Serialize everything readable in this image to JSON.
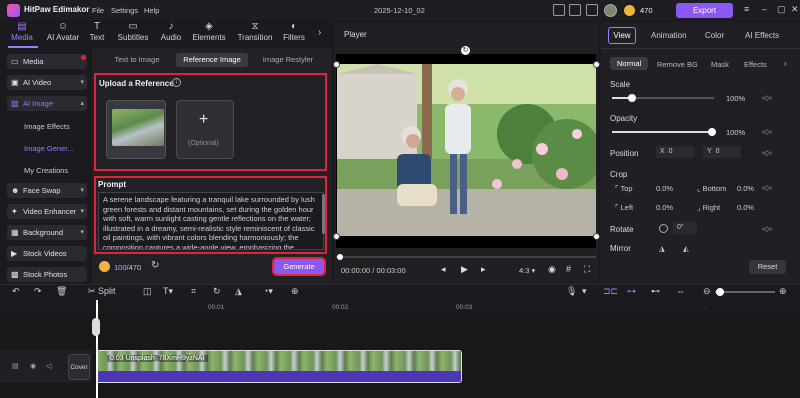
{
  "app": {
    "name": "HitPaw Edimakor",
    "menus": [
      "File",
      "Settings",
      "Help"
    ],
    "doc_title": "2025-12-10_02",
    "coins": "470",
    "export_label": "Export"
  },
  "toolbar": {
    "items": [
      {
        "label": "Media",
        "icon": "media-icon"
      },
      {
        "label": "AI Avatar",
        "icon": "ai-avatar-icon"
      },
      {
        "label": "Text",
        "icon": "text-icon"
      },
      {
        "label": "Subtitles",
        "icon": "subtitles-icon"
      },
      {
        "label": "Audio",
        "icon": "audio-icon"
      },
      {
        "label": "Elements",
        "icon": "elements-icon"
      },
      {
        "label": "Transition",
        "icon": "transition-icon"
      },
      {
        "label": "Filters",
        "icon": "filters-icon"
      }
    ]
  },
  "sidebar": {
    "items": [
      "Media",
      "AI Video",
      "AI Image",
      "Face Swap",
      "Video Enhancer",
      "Background",
      "Stock Videos",
      "Stock Photos"
    ],
    "subitems": [
      "Image Effects",
      "Image Gener...",
      "My Creations"
    ]
  },
  "center": {
    "tabs": [
      "Text to Image",
      "Reference Image",
      "Image Restyler"
    ],
    "upload_title": "Upload a Reference",
    "optional": "(Optional)",
    "prompt_title": "Prompt",
    "prompt_text": "A serene landscape featuring a tranquil lake surrounded by lush green forests and distant mountains, set during the golden hour with soft, warm sunlight casting gentle reflections on the water; illustrated in a dreamy, semi-realistic style reminiscent of classic oil paintings, with vibrant colors blending harmoniously; the composition captures a wide-angle view, emphasizing the",
    "credits_used": "100",
    "credits_total": "/470",
    "generate_label": "Generate"
  },
  "player": {
    "title": "Player",
    "time": "00:00:00 / 00:03:00",
    "aspect": "4:3"
  },
  "props": {
    "tabs": [
      "View",
      "Animation",
      "Color",
      "AI Effects"
    ],
    "subtabs": [
      "Normal",
      "Remove BG",
      "Mask",
      "Effects"
    ],
    "scale_label": "Scale",
    "scale_value": "100%",
    "opacity_label": "Opacity",
    "opacity_value": "100%",
    "position_label": "Position",
    "pos_x_label": "X",
    "pos_x": "0",
    "pos_y_label": "Y",
    "pos_y": "0",
    "crop_label": "Crop",
    "crop": [
      {
        "label": "Top",
        "value": "0.0%"
      },
      {
        "label": "Bottom",
        "value": "0.0%"
      },
      {
        "label": "Left",
        "value": "0.0%"
      },
      {
        "label": "Right",
        "value": "0.0%"
      }
    ],
    "rotate_label": "Rotate",
    "rotate_value": "0",
    "rotate_unit": "°",
    "mirror_label": "Mirror",
    "reset_label": "Reset"
  },
  "timeline": {
    "split_label": "Split",
    "ticks": [
      "00:01",
      "00:02",
      "00:03"
    ],
    "cover_label": "Cover",
    "clip_label": "0:03 Unsplash_78XmH9yzNAI"
  },
  "colors": {
    "accent": "#8b58f5",
    "highlight": "#e0253b",
    "active_text": "#9c7cff"
  }
}
